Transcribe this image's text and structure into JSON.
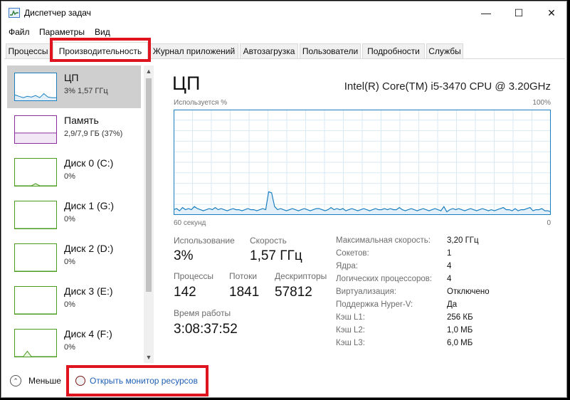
{
  "window": {
    "title": "Диспетчер задач",
    "minimize": "—",
    "maximize": "☐",
    "close": "✕"
  },
  "menu": [
    "Файл",
    "Параметры",
    "Вид"
  ],
  "tabs": [
    "Процессы",
    "Производительность",
    "Журнал приложений",
    "Автозагрузка",
    "Пользователи",
    "Подробности",
    "Службы"
  ],
  "active_tab": "Производительность",
  "sidebar": [
    {
      "name": "ЦП",
      "value": "3% 1,57 ГГц",
      "color": "#1a7fc1",
      "fill": "#e3f0f9",
      "level": [
        0.2,
        0.15,
        0.1,
        0.15,
        0.12,
        0.18,
        0.1,
        0.25,
        0.12,
        0.1,
        0.1
      ]
    },
    {
      "name": "Память",
      "value": "2,9/7,9 ГБ (37%)",
      "color": "#8b2d9c",
      "fill": "#f2e7f5",
      "level": [
        0.37,
        0.37,
        0.37,
        0.37,
        0.37,
        0.37,
        0.37,
        0.37,
        0.37,
        0.37,
        0.37
      ]
    },
    {
      "name": "Диск 0 (C:)",
      "value": "0%",
      "color": "#4a9c1f",
      "fill": "#eaf5e2",
      "level": [
        0,
        0,
        0,
        0,
        0,
        0.08,
        0,
        0,
        0,
        0,
        0
      ]
    },
    {
      "name": "Диск 1 (G:)",
      "value": "0%",
      "color": "#4a9c1f",
      "fill": "#eaf5e2",
      "level": [
        0,
        0,
        0,
        0,
        0,
        0,
        0,
        0,
        0,
        0,
        0
      ]
    },
    {
      "name": "Диск 2 (D:)",
      "value": "0%",
      "color": "#4a9c1f",
      "fill": "#eaf5e2",
      "level": [
        0,
        0,
        0,
        0,
        0,
        0,
        0,
        0,
        0,
        0,
        0
      ]
    },
    {
      "name": "Диск 3 (E:)",
      "value": "0%",
      "color": "#4a9c1f",
      "fill": "#eaf5e2",
      "level": [
        0,
        0,
        0,
        0,
        0,
        0,
        0,
        0,
        0,
        0,
        0
      ]
    },
    {
      "name": "Диск 4 (F:)",
      "value": "0%",
      "color": "#4a9c1f",
      "fill": "#eaf5e2",
      "level": [
        0,
        0,
        0,
        0.2,
        0,
        0,
        0,
        0,
        0,
        0,
        0
      ]
    }
  ],
  "main": {
    "title": "ЦП",
    "model": "Intel(R) Core(TM) i5-3470 CPU @ 3.20GHz",
    "graph_top_left": "Используется %",
    "graph_top_right": "100%",
    "graph_bottom_left": "60 секунд",
    "graph_bottom_right": "0",
    "graph_color": "#1a7fc1",
    "graph_fill": "#e3f0f9",
    "graph_grid_color": "#d9eaf4",
    "usage_history_percent": [
      5,
      6,
      4,
      7,
      5,
      6,
      5,
      8,
      6,
      5,
      4,
      5,
      6,
      5,
      7,
      5,
      6,
      5,
      4,
      5,
      6,
      5,
      5,
      4,
      5,
      6,
      5,
      5,
      4,
      5,
      6,
      5,
      22,
      21,
      8,
      5,
      6,
      5,
      4,
      5,
      6,
      5,
      4,
      5,
      6,
      5,
      4,
      5,
      6,
      6,
      5,
      4,
      5,
      7,
      5,
      6,
      5,
      6,
      4,
      5,
      6,
      5,
      4,
      5,
      6,
      5,
      4,
      5,
      6,
      5,
      5,
      6,
      5,
      6,
      5,
      5,
      7,
      5,
      4,
      5,
      6,
      5,
      4,
      5,
      6,
      5,
      4,
      5,
      6,
      5,
      4,
      8,
      3,
      5,
      6,
      5,
      6,
      5,
      4,
      5,
      6,
      5,
      4,
      5,
      6,
      5,
      4,
      5,
      4,
      5,
      6,
      7,
      5,
      5,
      4,
      6,
      4,
      5,
      5,
      6,
      7,
      4,
      5,
      5,
      6,
      4,
      4,
      3
    ],
    "stats": {
      "usage_label": "Использование",
      "usage": "3%",
      "speed_label": "Скорость",
      "speed": "1,57 ГГц",
      "processes_label": "Процессы",
      "processes": "142",
      "threads_label": "Потоки",
      "threads": "1841",
      "handles_label": "Дескрипторы",
      "handles": "57812",
      "uptime_label": "Время работы",
      "uptime": "3:08:37:52"
    },
    "specs": [
      {
        "key": "Максимальная скорость:",
        "value": "3,20 ГГц"
      },
      {
        "key": "Сокетов:",
        "value": "1"
      },
      {
        "key": "Ядра:",
        "value": "4"
      },
      {
        "key": "Логических процессоров:",
        "value": "4"
      },
      {
        "key": "Виртуализация:",
        "value": "Отключено"
      },
      {
        "key": "Поддержка Hyper-V:",
        "value": "Да"
      },
      {
        "key": "Кэш L1:",
        "value": "256 КБ"
      },
      {
        "key": "Кэш L2:",
        "value": "1,0 МБ"
      },
      {
        "key": "Кэш L3:",
        "value": "6,0 МБ"
      }
    ]
  },
  "footer": {
    "less_label": "Меньше",
    "resmon_label": "Открыть монитор ресурсов"
  },
  "highlight_color": "#e0141e"
}
